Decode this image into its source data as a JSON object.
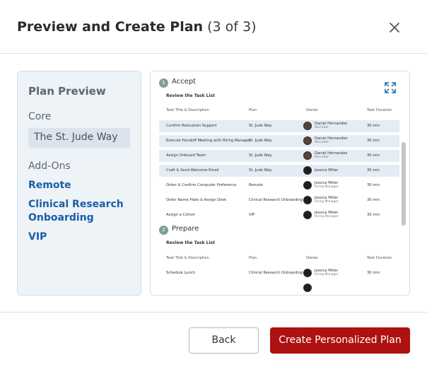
{
  "header": {
    "title": "Preview and Create Plan",
    "step": "(3 of 3)"
  },
  "sidebar": {
    "heading": "Plan Preview",
    "core_label": "Core",
    "core_value": "The St. Jude Way",
    "addons_label": "Add-Ons",
    "addons": [
      "Remote",
      "Clinical Research Onboarding",
      "VIP"
    ]
  },
  "preview": {
    "sections": [
      {
        "number": "1",
        "title": "Accept",
        "subtitle": "Review the Task List",
        "columns": [
          "Task Title & Description",
          "Plan",
          "Owner",
          "Task Duration"
        ],
        "rows": [
          {
            "task": "Confirm Relocation Support",
            "plan": "St. Jude Way",
            "owner": "Daniel Hernandez",
            "role": "Recruiter",
            "duration": "30 min"
          },
          {
            "task": "Execute Handoff Meeting with Hiring Manager",
            "plan": "St. Jude Way",
            "owner": "Daniel Hernandez",
            "role": "Recruiter",
            "duration": "30 min"
          },
          {
            "task": "Assign Onboard Team",
            "plan": "St. Jude Way",
            "owner": "Daniel Hernandez",
            "role": "Recruiter",
            "duration": "30 min"
          },
          {
            "task": "Craft & Send Welcome Email",
            "plan": "St. Jude Way",
            "owner": "Jessica Miller",
            "role": "",
            "duration": "30 min"
          },
          {
            "task": "Order & Confirm Computer Preference",
            "plan": "Remote",
            "owner": "Jessica Miller",
            "role": "Hiring Manager",
            "duration": "30 min"
          },
          {
            "task": "Order Name Plate & Assign Desk",
            "plan": "Clinical Research Onboarding",
            "owner": "Jessica Miller",
            "role": "Hiring Manager",
            "duration": "30 min"
          },
          {
            "task": "Assign a Cohort",
            "plan": "VIP",
            "owner": "Jessica Miller",
            "role": "Hiring Manager",
            "duration": "30 min"
          }
        ]
      },
      {
        "number": "2",
        "title": "Prepare",
        "subtitle": "Review the Task List",
        "columns": [
          "Task Title & Description",
          "Plan",
          "Owner",
          "Task Duration"
        ],
        "rows": [
          {
            "task": "Schedule Lunch",
            "plan": "Clinical Research Onboarding",
            "owner": "Jessica Miller",
            "role": "Hiring Manager",
            "duration": "30 min"
          }
        ]
      }
    ]
  },
  "footer": {
    "back_label": "Back",
    "create_label": "Create Personalized Plan"
  },
  "colors": {
    "accent": "#ad1111",
    "link": "#1a5fa3",
    "sidebar_bg": "#eef3f8",
    "highlight_row": "#e4ecf6",
    "step_badge": "#7f9e97"
  },
  "icons": {
    "close": "close-icon",
    "expand": "expand-icon"
  }
}
